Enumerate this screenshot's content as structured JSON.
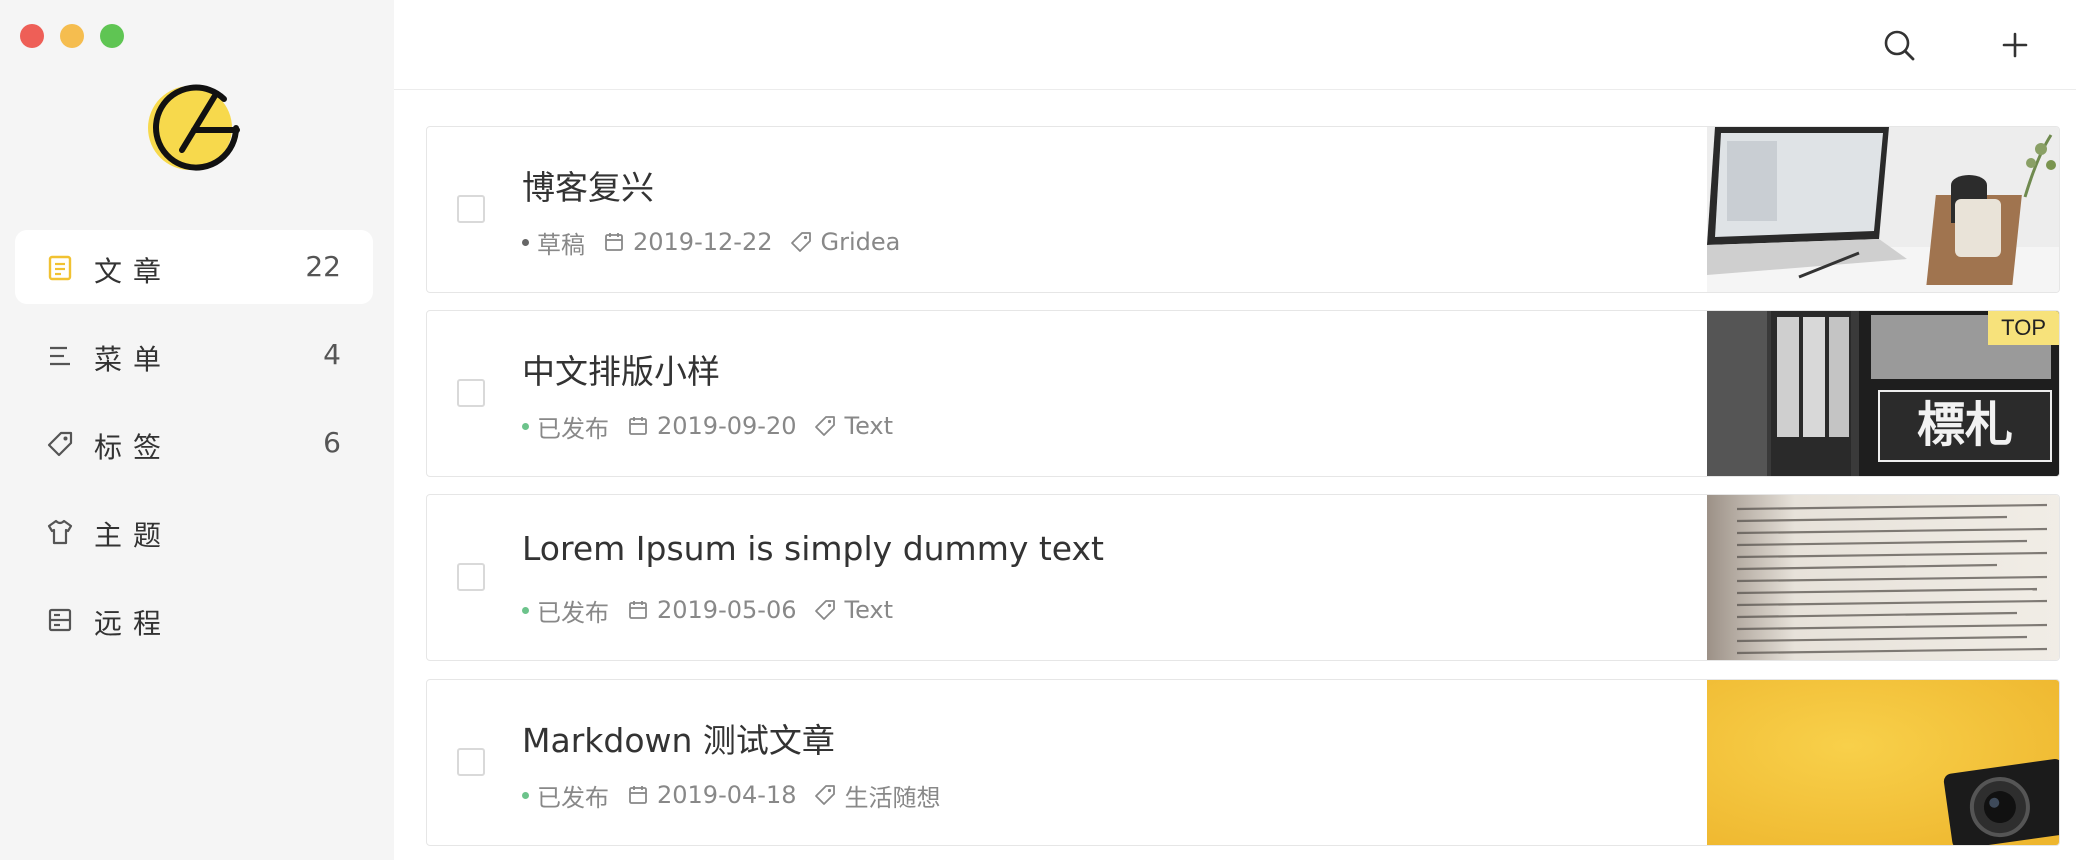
{
  "sidebar": {
    "items": [
      {
        "label": "文章",
        "count": "22",
        "icon": "article-icon"
      },
      {
        "label": "菜单",
        "count": "4",
        "icon": "menu-icon"
      },
      {
        "label": "标签",
        "count": "6",
        "icon": "tag-icon"
      },
      {
        "label": "主题",
        "count": "",
        "icon": "theme-shirt-icon"
      },
      {
        "label": "远程",
        "count": "",
        "icon": "remote-icon"
      }
    ]
  },
  "header": {
    "search_icon": "search-icon",
    "add_icon": "plus-icon"
  },
  "posts": [
    {
      "title": "博客复兴",
      "status": "草稿",
      "date": "2019-12-22",
      "tag": "Gridea",
      "top": false
    },
    {
      "title": "中文排版小样",
      "status": "已发布",
      "date": "2019-09-20",
      "tag": "Text",
      "top": true,
      "top_label": "TOP"
    },
    {
      "title": "Lorem Ipsum is simply dummy text",
      "status": "已发布",
      "date": "2019-05-06",
      "tag": "Text",
      "top": false
    },
    {
      "title": "Markdown 测试文章",
      "status": "已发布",
      "date": "2019-04-18",
      "tag": "生活随想",
      "top": false
    }
  ],
  "colors": {
    "accent": "#f7d94c",
    "published": "#6cc38b",
    "sidebar_bg": "#f5f5f5"
  }
}
